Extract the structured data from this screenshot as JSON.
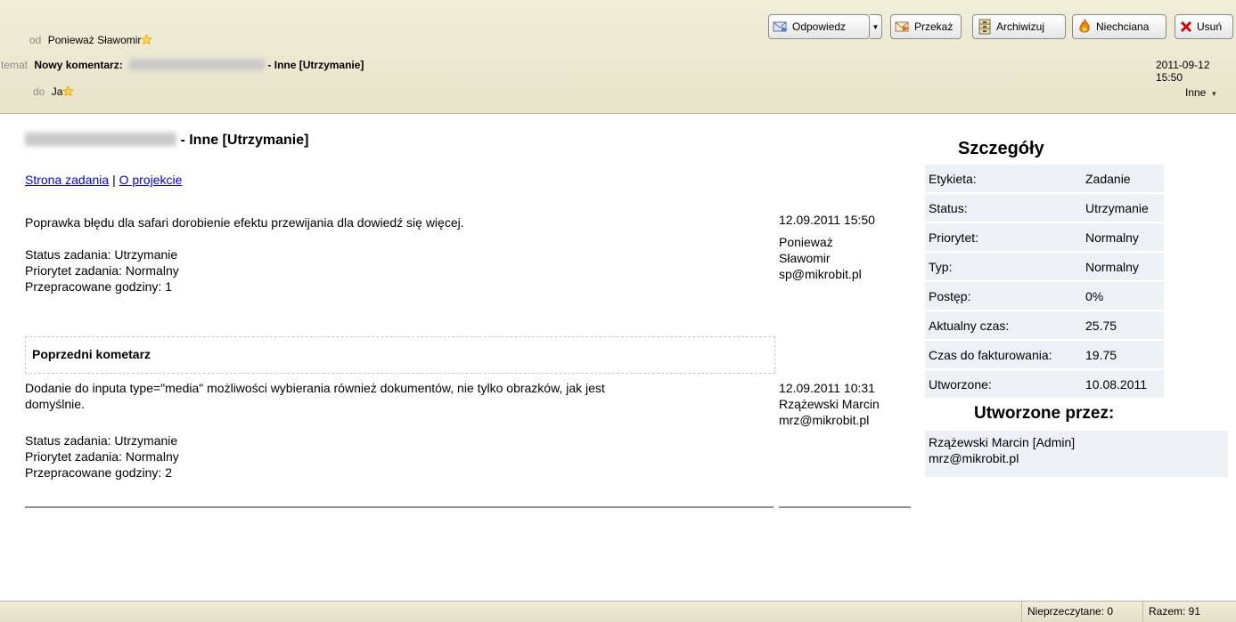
{
  "header": {
    "from_label": "od",
    "from_name": "Ponieważ Sławomir",
    "subject_label": "temat",
    "subject_prefix": "Nowy komentarz:",
    "subject_suffix": " - Inne [Utrzymanie]",
    "to_label": "do",
    "to_name": "Ja",
    "date": "2011-09-12 15:50",
    "folder": "Inne"
  },
  "toolbar": {
    "reply": "Odpowiedz",
    "forward": "Przekaż",
    "archive": "Archiwizuj",
    "junk": "Niechciana",
    "delete": "Usuń"
  },
  "message": {
    "title_suffix": " - Inne [Utrzymanie]",
    "task_link": "Strona zadania",
    "separator": "|",
    "project_link": "O projekcie",
    "comment": {
      "text": "Poprawka błędu dla safari dorobienie efektu przewijania dla dowiedź się więcej.",
      "status": "Status zadania: Utrzymanie",
      "priority": "Priorytet zadania: Normalny",
      "hours": "Przepracowane godziny: 1",
      "date": "12.09.2011 15:50",
      "author_line1": "Ponieważ",
      "author_line2": "Sławomir",
      "email": "sp@mikrobit.pl"
    },
    "previous_heading": "Poprzedni kometarz",
    "previous": {
      "text_line1": "Dodanie do inputa type=\"media\" możliwości wybierania również dokumentów, nie tylko obrazków, jak jest",
      "text_line2": "domyślnie.",
      "status": "Status zadania: Utrzymanie",
      "priority": "Priorytet zadania: Normalny",
      "hours": "Przepracowane godziny: 2",
      "date": "12.09.2011 10:31",
      "author": "Rzążewski Marcin",
      "email": "mrz@mikrobit.pl"
    }
  },
  "details": {
    "title": "Szczegóły",
    "rows": [
      {
        "key": "Etykieta:",
        "value": "Zadanie"
      },
      {
        "key": "Status:",
        "value": "Utrzymanie"
      },
      {
        "key": "Priorytet:",
        "value": "Normalny"
      },
      {
        "key": "Typ:",
        "value": "Normalny"
      },
      {
        "key": "Postęp:",
        "value": "0%"
      },
      {
        "key": "Aktualny czas:",
        "value": "25.75"
      },
      {
        "key": "Czas do fakturowania:",
        "value": "19.75"
      },
      {
        "key": "Utworzone:",
        "value": "10.08.2011"
      }
    ],
    "created_by_title": "Utworzone przez:",
    "created_by_name": "Rzążewski Marcin [Admin]",
    "created_by_email": "mrz@mikrobit.pl"
  },
  "statusbar": {
    "unread": "Nieprzeczytane: 0",
    "total": "Razem: 91"
  },
  "icons": {
    "star": "star-icon",
    "reply": "reply-icon",
    "forward": "forward-icon",
    "archive": "archive-icon",
    "junk": "junk-icon",
    "delete": "delete-icon"
  },
  "colors": {
    "header_bg": "#efecd6",
    "link": "#0000ee",
    "details_bg": "#edf0f4",
    "delete_red": "#d40000",
    "junk_orange": "#f08a00"
  }
}
